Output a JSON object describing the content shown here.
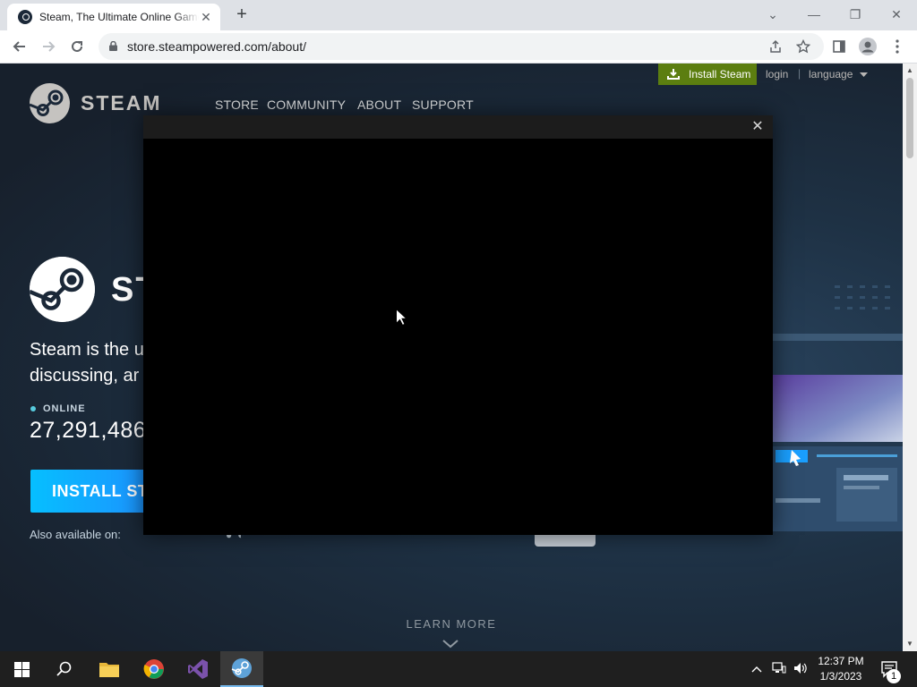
{
  "browser": {
    "tab_title": "Steam, The Ultimate Online Game Platform",
    "tab_close": "✕",
    "new_tab": "+",
    "url": "store.steampowered.com/about/"
  },
  "window_controls": {
    "minimize": "—",
    "restore": "❐",
    "close": "✕",
    "tab_search": "⌄"
  },
  "steam": {
    "install_steam_label": "Install Steam",
    "login_label": "login",
    "separator": "|",
    "language_label": "language",
    "logo_word": "STEAM",
    "nav": [
      "STORE",
      "COMMUNITY",
      "ABOUT",
      "SUPPORT"
    ],
    "hero_word": "ST",
    "hero_line1": "Steam is the u",
    "hero_line2": "discussing, ar",
    "online_label": "ONLINE",
    "online_count": "27,291,486",
    "install_button_label": "INSTALL ST",
    "also_available": "Also available on:",
    "learn_more": "LEARN MORE",
    "accent_green": "#5c7e10",
    "accent_blue": "#06bfff"
  },
  "modal": {
    "close_label": "✕"
  },
  "taskbar": {
    "apps": [
      "start-icon",
      "search-icon",
      "file-explorer-icon",
      "chrome-icon",
      "visual-studio-icon",
      "steam-icon"
    ],
    "time": "12:37 PM",
    "date": "1/3/2023",
    "notification_count": "1"
  }
}
